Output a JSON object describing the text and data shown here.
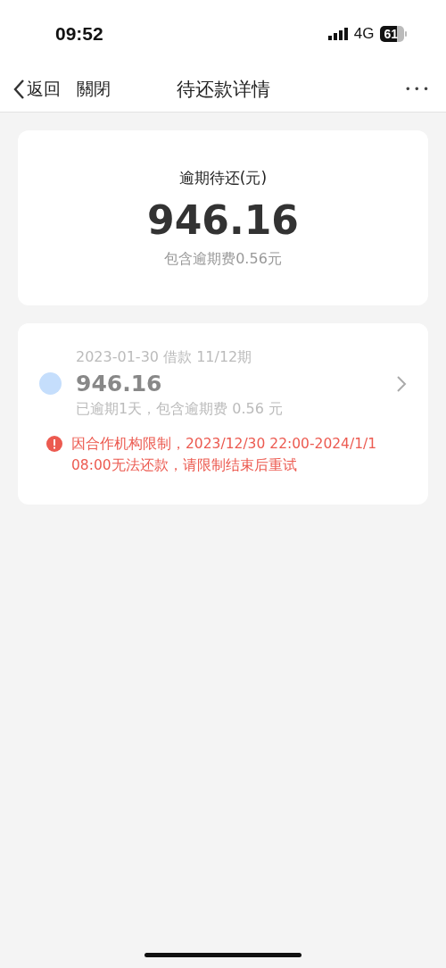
{
  "status_bar": {
    "time": "09:52",
    "network": "4G",
    "battery": "61"
  },
  "nav": {
    "back": "返回",
    "close": "關閉",
    "title": "待还款详情",
    "more": "•••"
  },
  "summary": {
    "label": "逾期待还(元)",
    "amount": "946.16",
    "note": "包含逾期费0.56元"
  },
  "bills": [
    {
      "date_line": "2023-01-30 借款 11/12期",
      "amount": "946.16",
      "detail": "已逾期1天，包含逾期费 0.56 元",
      "color": "#c5defc",
      "warning": "因合作机构限制，2023/12/30 22:00-2024/1/1 08:00无法还款，请限制结束后重试"
    }
  ]
}
